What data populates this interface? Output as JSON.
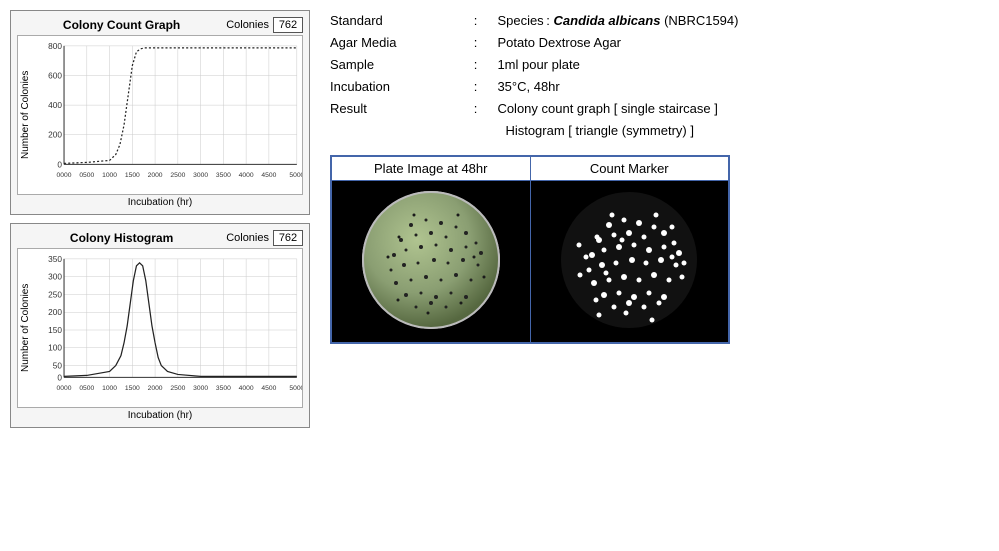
{
  "left_panel": {
    "colony_count_graph": {
      "title": "Colony Count Graph",
      "colonies_label": "Colonies",
      "colonies_value": "762",
      "y_axis_label": "Number of Colonies",
      "x_axis_label": "Incubation (hr)",
      "y_ticks": [
        "800",
        "600",
        "400",
        "200",
        "0"
      ],
      "x_ticks": [
        "0000",
        "0500",
        "1000",
        "1500",
        "2000",
        "2500",
        "3000",
        "3500",
        "4000",
        "4500",
        "5000"
      ]
    },
    "colony_histogram": {
      "title": "Colony Histogram",
      "colonies_label": "Colonies",
      "colonies_value": "762",
      "y_axis_label": "Number of Colonies",
      "x_axis_label": "Incubation (hr)",
      "y_ticks": [
        "350",
        "300",
        "250",
        "200",
        "150",
        "100",
        "50",
        "0"
      ],
      "x_ticks": [
        "0000",
        "0500",
        "1000",
        "1500",
        "2000",
        "2500",
        "3000",
        "3500",
        "4000",
        "4500",
        "5000"
      ]
    }
  },
  "right_panel": {
    "info": {
      "standard_label": "Standard",
      "standard_value_prefix": "Species :",
      "standard_species": "Candida albicans",
      "standard_nbrc": "(NBRC1594)",
      "agar_label": "Agar Media",
      "agar_value": "Potato Dextrose Agar",
      "sample_label": "Sample",
      "sample_value": "1ml pour  plate",
      "incubation_label": "Incubation",
      "incubation_value": "35°C,  48hr",
      "result_label": "Result",
      "result_value1": ": Colony count graph [ single staircase ]",
      "result_value2": "Histogram [ triangle (symmetry) ]"
    },
    "images": {
      "plate_header": "Plate Image at 48hr",
      "count_header": "Count Marker"
    }
  }
}
